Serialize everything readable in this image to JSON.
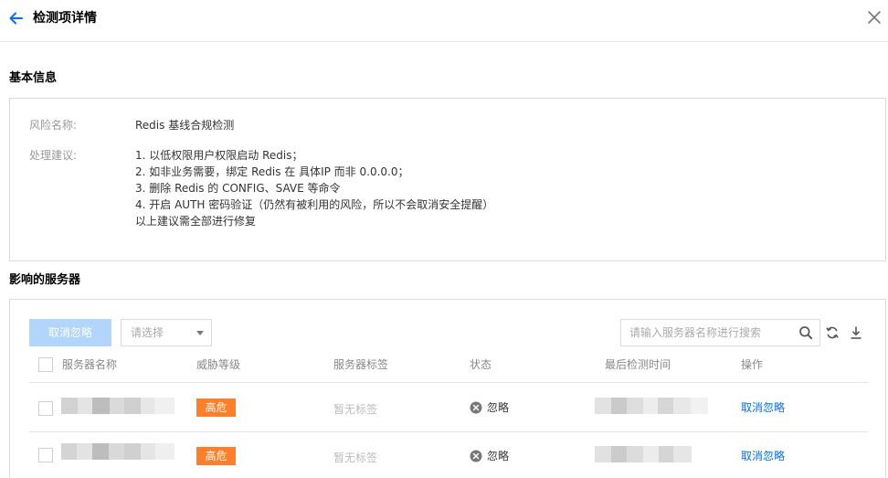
{
  "header": {
    "title": "检测项详情"
  },
  "basic_info": {
    "section_title": "基本信息",
    "risk_name_label": "风险名称:",
    "risk_name_value": "Redis 基线合规检测",
    "advice_label": "处理建议:",
    "advice_lines": [
      "1. 以低权限用户权限启动 Redis；",
      "2. 如非业务需要，绑定 Redis 在 具体IP 而非 0.0.0.0；",
      "3. 删除 Redis 的 CONFIG、SAVE 等命令",
      "4. 开启 AUTH 密码验证（仍然有被利用的风险，所以不会取消安全提醒）",
      "以上建议需全部进行修复"
    ]
  },
  "servers": {
    "section_title": "影响的服务器",
    "toolbar": {
      "cancel_ignore_label": "取消忽略",
      "select_placeholder": "请选择",
      "search_placeholder": "请输入服务器名称进行搜索"
    },
    "columns": [
      "服务器名称",
      "威胁等级",
      "服务器标签",
      "状态",
      "最后检测时间",
      "操作"
    ],
    "rows": [
      {
        "level": "高危",
        "tags": "暂无标签",
        "status": "忽略",
        "action": "取消忽略"
      },
      {
        "level": "高危",
        "tags": "暂无标签",
        "status": "忽略",
        "action": "取消忽略"
      }
    ]
  },
  "colors": {
    "accent": "#006eff",
    "disabled_button": "#b1d5fb",
    "danger_badge": "#ff7e29",
    "border": "#dcdcdc"
  },
  "icons": [
    "back-arrow-icon",
    "close-icon",
    "chevron-down-icon",
    "search-icon",
    "refresh-icon",
    "download-icon",
    "ignore-status-icon"
  ]
}
